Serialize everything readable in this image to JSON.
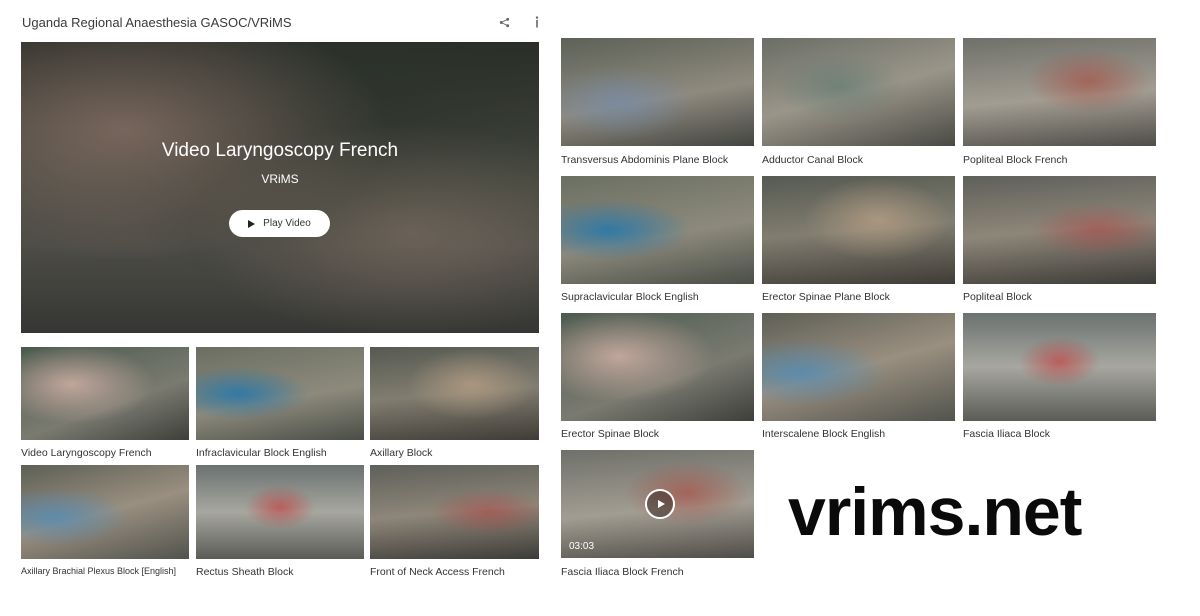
{
  "header": {
    "title": "Uganda Regional Anaesthesia GASOC/VRiMS",
    "share_icon": "share-icon",
    "info_icon": "info-icon"
  },
  "featured": {
    "title": "Video Laryngoscopy French",
    "subtitle": "VRiMS",
    "play_label": "Play Video"
  },
  "left_grid": [
    {
      "caption": "Video Laryngoscopy French"
    },
    {
      "caption": "Infraclavicular Block English"
    },
    {
      "caption": "Axillary Block"
    },
    {
      "caption": "Axillary Brachial Plexus Block [English]"
    },
    {
      "caption": "Rectus Sheath Block"
    },
    {
      "caption": "Front of Neck Access French"
    }
  ],
  "right_grid": [
    {
      "caption": "Transversus Abdominis Plane Block"
    },
    {
      "caption": "Adductor Canal Block"
    },
    {
      "caption": "Popliteal Block French"
    },
    {
      "caption": "Supraclavicular Block English"
    },
    {
      "caption": "Erector Spinae Plane Block"
    },
    {
      "caption": "Popliteal Block"
    },
    {
      "caption": "Erector Spinae Block"
    },
    {
      "caption": "Interscalene Block English"
    },
    {
      "caption": "Fascia Iliaca Block"
    },
    {
      "caption": "Fascia Iliaca Block French",
      "duration": "03:03"
    }
  ],
  "brand": {
    "text": "vrims.net"
  },
  "colors": {
    "background": "#ffffff",
    "text": "#333333",
    "brand": "#0a0a0a"
  }
}
